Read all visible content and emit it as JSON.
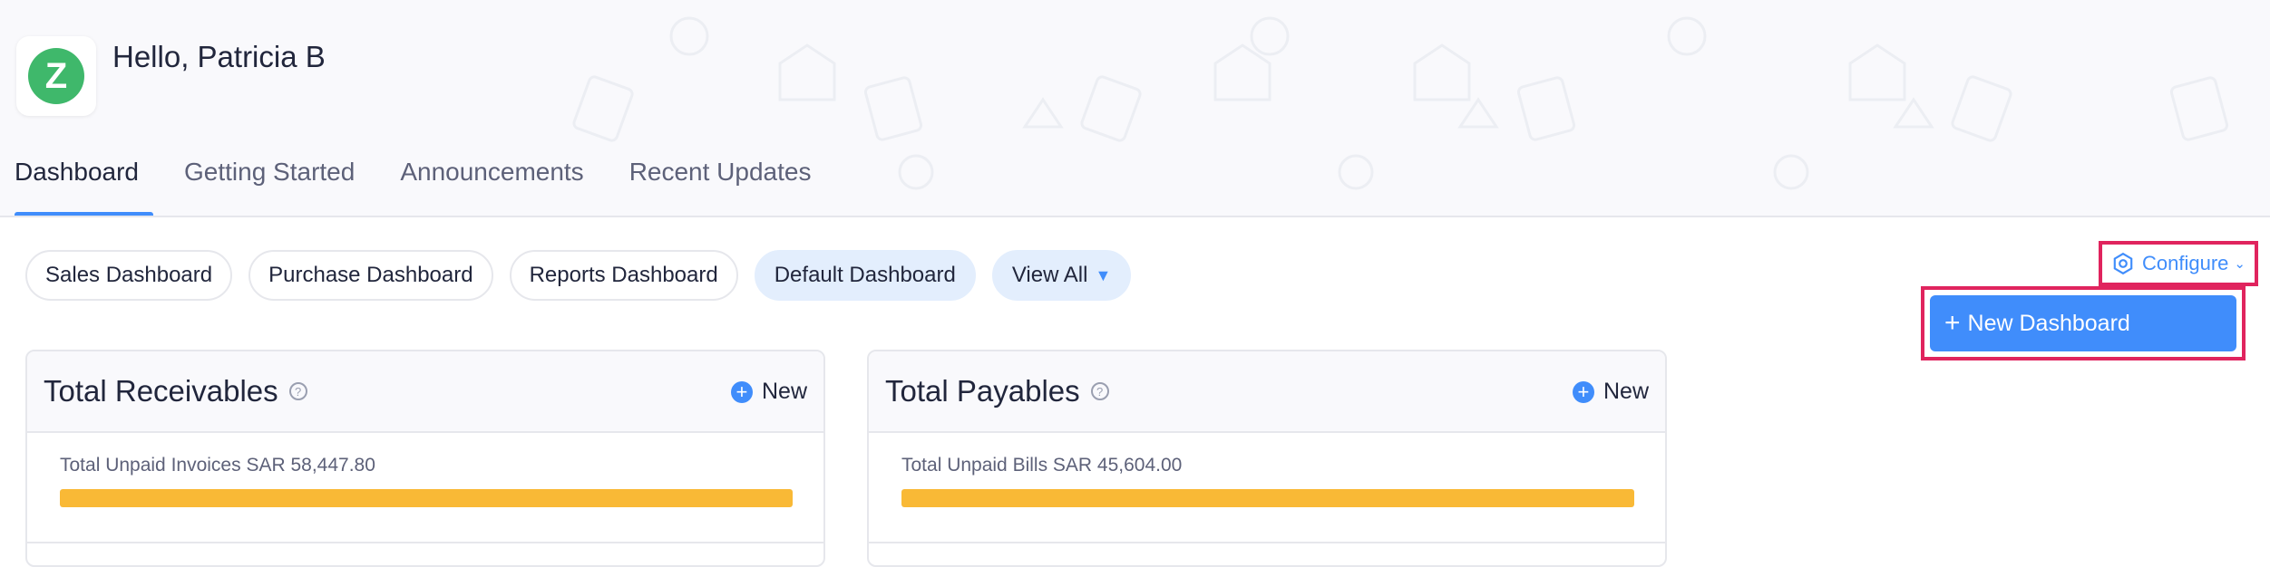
{
  "header": {
    "logo_letter": "Z",
    "greeting": "Hello, Patricia B",
    "tabs": [
      {
        "label": "Dashboard",
        "active": true
      },
      {
        "label": "Getting Started",
        "active": false
      },
      {
        "label": "Announcements",
        "active": false
      },
      {
        "label": "Recent Updates",
        "active": false
      }
    ]
  },
  "dashboards": {
    "chips": [
      {
        "label": "Sales Dashboard"
      },
      {
        "label": "Purchase Dashboard"
      },
      {
        "label": "Reports Dashboard"
      },
      {
        "label": "Default Dashboard",
        "active": true
      }
    ],
    "view_all": "View All"
  },
  "configure": {
    "label": "Configure",
    "menu_item": "New Dashboard"
  },
  "cards": {
    "receivables": {
      "title": "Total Receivables",
      "new_label": "New",
      "unpaid_label": "Total Unpaid Invoices SAR 58,447.80",
      "progress_fraction": 1.0
    },
    "payables": {
      "title": "Total Payables",
      "new_label": "New",
      "unpaid_label": "Total Unpaid Bills SAR 45,604.00",
      "progress_fraction": 1.0
    }
  },
  "colors": {
    "accent": "#408dfb",
    "highlight_border": "#e0245e",
    "logo_green": "#3fb86b",
    "progress": "#f9b936"
  },
  "icons": {
    "configure": "settings-hexagon-icon",
    "help": "question-circle-icon",
    "new": "plus-circle-icon"
  }
}
